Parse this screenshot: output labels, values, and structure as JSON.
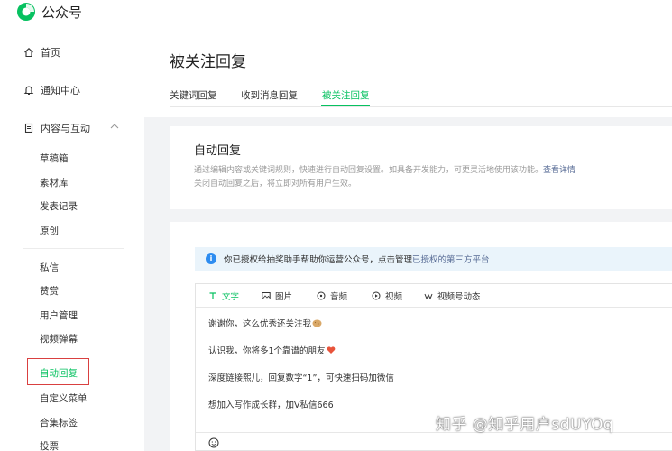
{
  "app": {
    "title": "公众号"
  },
  "sidebar": {
    "home": "首页",
    "notifications": "通知中心",
    "content": "内容与互动",
    "content_items": [
      "草稿箱",
      "素材库",
      "发表记录",
      "原创"
    ],
    "interact_items": [
      "私信",
      "赞赏",
      "用户管理",
      "视频弹幕",
      "自动回复",
      "自定义菜单",
      "合集标签",
      "投票"
    ]
  },
  "page": {
    "title": "被关注回复"
  },
  "tabs": [
    "关键词回复",
    "收到消息回复",
    "被关注回复"
  ],
  "auto": {
    "title": "自动回复",
    "desc_line1": "通过编辑内容或关键词规则，快速进行自动回复设置。如具备开发能力，可更灵活地使用该功能。",
    "desc_link": "查看详情",
    "desc_line2": "关闭自动回复之后，将立即对所有用户生效。"
  },
  "notice": {
    "text": "你已授权给抽奖助手帮助你运营公众号，点击管理",
    "link": "已授权的第三方平台"
  },
  "editor": {
    "tabs": [
      "文字",
      "图片",
      "音频",
      "视频",
      "视频号动态"
    ],
    "lines": [
      "谢谢你，这么优秀还关注我",
      "认识我，你将多1个靠谱的朋友",
      "深度链接熙儿，回复数字“1”，可快速扫码加微信",
      "想加入写作成长群，加V私信666"
    ]
  },
  "watermark": "知乎 @知乎用户sdUYOq",
  "colors": {
    "accent": "#07c160",
    "link": "#576b95",
    "selection": "#d94040"
  }
}
